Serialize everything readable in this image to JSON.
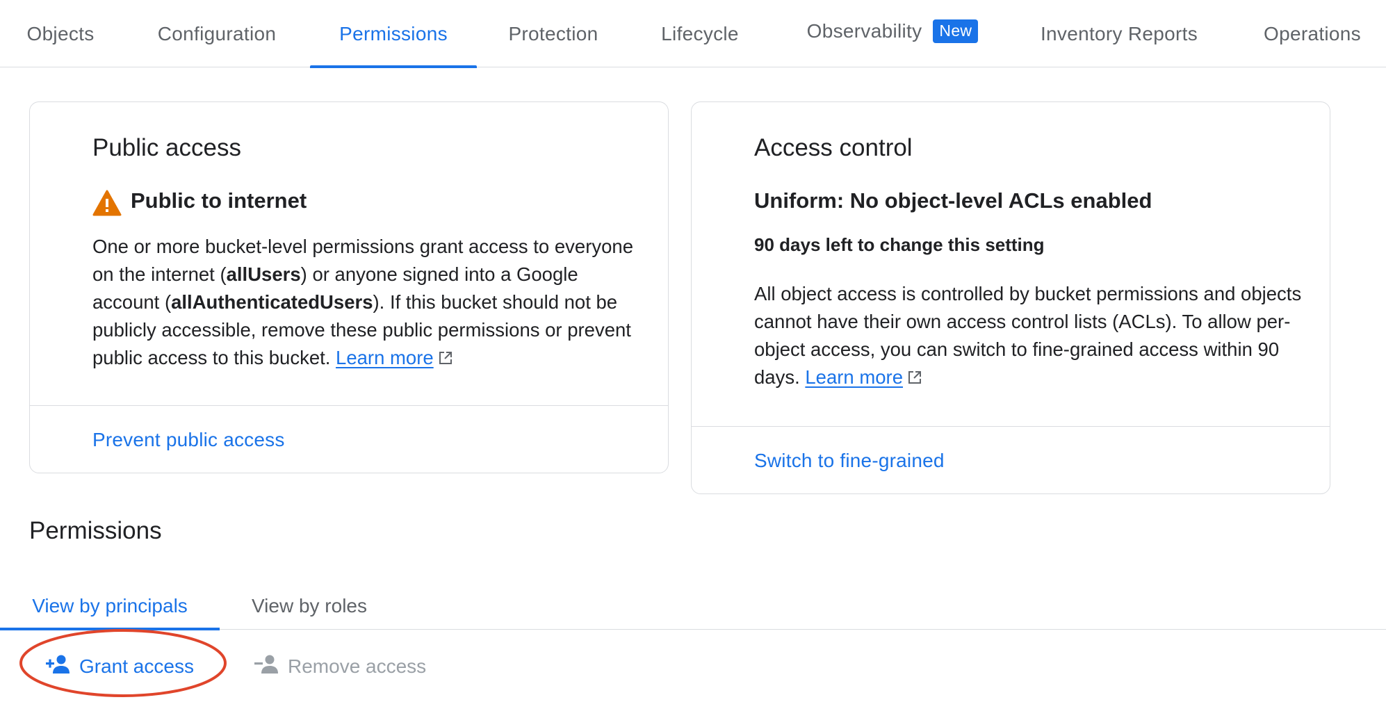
{
  "tabs": [
    {
      "label": "Objects"
    },
    {
      "label": "Configuration"
    },
    {
      "label": "Permissions"
    },
    {
      "label": "Protection"
    },
    {
      "label": "Lifecycle"
    },
    {
      "label": "Observability",
      "badge": "New"
    },
    {
      "label": "Inventory Reports"
    },
    {
      "label": "Operations"
    }
  ],
  "active_tab": "Permissions",
  "public_access": {
    "title": "Public access",
    "status": "Public to internet",
    "text_1": "One or more bucket-level permissions grant access to everyone on the internet (",
    "bold_1": "allUsers",
    "text_2": ") or anyone signed into a Google account (",
    "bold_2": "allAuthenticatedUsers",
    "text_3": "). If this bucket should not be publicly accessible, remove these public permissions or prevent public access to this bucket. ",
    "learn_more": "Learn more",
    "action": "Prevent public access"
  },
  "access_control": {
    "title": "Access control",
    "status": "Uniform: No object-level ACLs enabled",
    "note": "90 days left to change this setting",
    "text": "All object access is controlled by bucket permissions and objects cannot have their own access control lists (ACLs). To allow per-object access, you can switch to fine-grained access within 90 days. ",
    "learn_more": "Learn more",
    "action": "Switch to fine-grained"
  },
  "permissions": {
    "title": "Permissions",
    "subtabs": [
      "View by principals",
      "View by roles"
    ],
    "grant_label": "Grant access",
    "remove_label": "Remove access"
  },
  "colors": {
    "accent": "#1a73e8",
    "warning": "#e37400",
    "highlight": "#e0452b"
  }
}
